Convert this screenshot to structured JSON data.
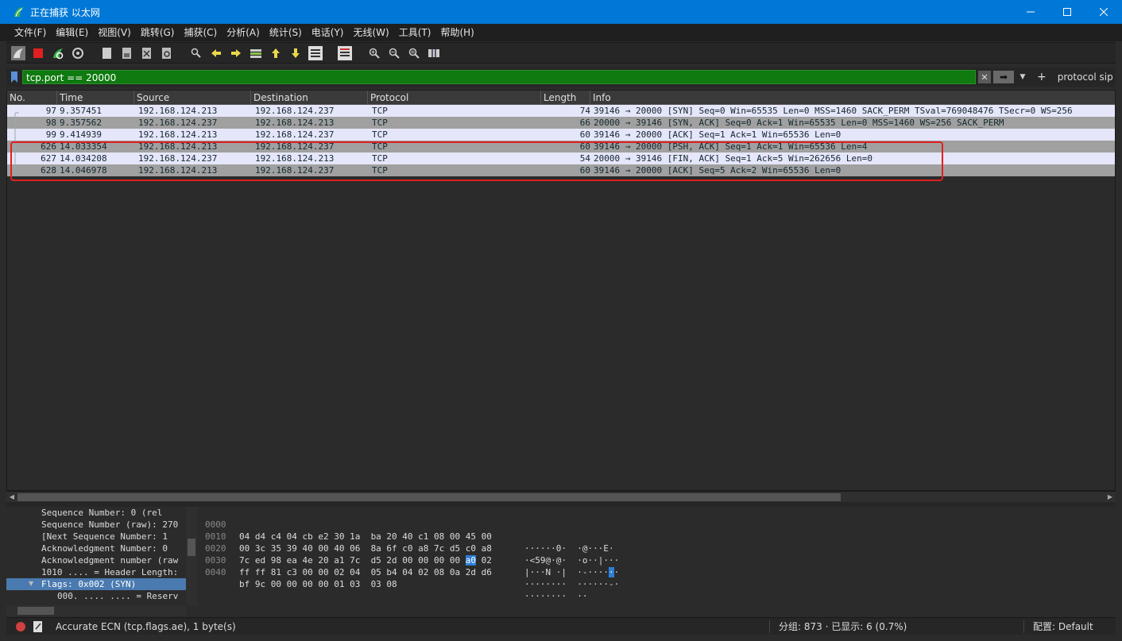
{
  "window": {
    "title": "正在捕获 以太网",
    "minimize": "—",
    "maximize": "☐",
    "close": "✕"
  },
  "menu": [
    "文件(F)",
    "编辑(E)",
    "视图(V)",
    "跳转(G)",
    "捕获(C)",
    "分析(A)",
    "统计(S)",
    "电话(Y)",
    "无线(W)",
    "工具(T)",
    "帮助(H)"
  ],
  "filter": {
    "value": "tcp.port == 20000",
    "button_label": "protocol sip",
    "plus": "+",
    "clear": "✕",
    "apply": "➡",
    "dropdown": "▼"
  },
  "packet_list": {
    "columns": [
      "No.",
      "Time",
      "Source",
      "Destination",
      "Protocol",
      "Length",
      "Info"
    ],
    "rows": [
      {
        "no": "97",
        "time": "9.357451",
        "src": "192.168.124.213",
        "dst": "192.168.124.237",
        "proto": "TCP",
        "len": "74",
        "info": "39146 → 20000 [SYN] Seq=0 Win=65535 Len=0 MSS=1460 SACK_PERM TSval=769048476 TSecr=0 WS=256"
      },
      {
        "no": "98",
        "time": "9.357562",
        "src": "192.168.124.237",
        "dst": "192.168.124.213",
        "proto": "TCP",
        "len": "66",
        "info": "20000 → 39146 [SYN, ACK] Seq=0 Ack=1 Win=65535 Len=0 MSS=1460 WS=256 SACK_PERM"
      },
      {
        "no": "99",
        "time": "9.414939",
        "src": "192.168.124.213",
        "dst": "192.168.124.237",
        "proto": "TCP",
        "len": "60",
        "info": "39146 → 20000 [ACK] Seq=1 Ack=1 Win=65536 Len=0"
      },
      {
        "no": "626",
        "time": "14.033354",
        "src": "192.168.124.213",
        "dst": "192.168.124.237",
        "proto": "TCP",
        "len": "60",
        "info": "39146 → 20000 [PSH, ACK] Seq=1 Ack=1 Win=65536 Len=4"
      },
      {
        "no": "627",
        "time": "14.034208",
        "src": "192.168.124.237",
        "dst": "192.168.124.213",
        "proto": "TCP",
        "len": "54",
        "info": "20000 → 39146 [FIN, ACK] Seq=1 Ack=5 Win=262656 Len=0"
      },
      {
        "no": "628",
        "time": "14.046978",
        "src": "192.168.124.213",
        "dst": "192.168.124.237",
        "proto": "TCP",
        "len": "60",
        "info": "39146 → 20000 [ACK] Seq=5 Ack=2 Win=65536 Len=0"
      }
    ]
  },
  "details": {
    "lines": [
      "Sequence Number: 0    (rel",
      "Sequence Number (raw): 270",
      "[Next Sequence Number: 1  ",
      "Acknowledgment Number: 0  ",
      "Acknowledgment number (raw",
      "1010 .... = Header Length:",
      "Flags: 0x002 (SYN)",
      "000. .... .... = Reserv"
    ]
  },
  "bytes": {
    "lines": [
      {
        "offset": "0000",
        "hex": "04 d4 c4 04 cb e2 30 1a  ba 20 40 c1 08 00 45 00",
        "ascii": "······0·  ·@···E·"
      },
      {
        "offset": "0010",
        "hex": "00 3c 35 39 40 00 40 06  8a 6f c0 a8 7c d5 c0 a8",
        "ascii": "·<59@·@·  ·o··|···"
      },
      {
        "offset": "0020",
        "hex": "7c ed 98 ea 4e 20 a1 7c  d5 2d 00 00 00 00 ",
        "hex_hl": "a0",
        "hex_tail": " 02",
        "ascii": "|···N ·|  ·-····",
        "ascii_hl": "·",
        "ascii_tail": "·"
      },
      {
        "offset": "0030",
        "hex": "ff ff 81 c3 00 00 02 04  05 b4 04 02 08 0a 2d d6",
        "ascii": "········  ······-·"
      },
      {
        "offset": "0040",
        "hex": "bf 9c 00 00 00 00 01 03  03 08",
        "ascii": "········  ··"
      }
    ]
  },
  "status": {
    "field_info": "Accurate ECN (tcp.flags.ae), 1 byte(s)",
    "packets": "分组: 873 · 已显示: 6 (0.7%)",
    "profile": "配置: Default"
  }
}
